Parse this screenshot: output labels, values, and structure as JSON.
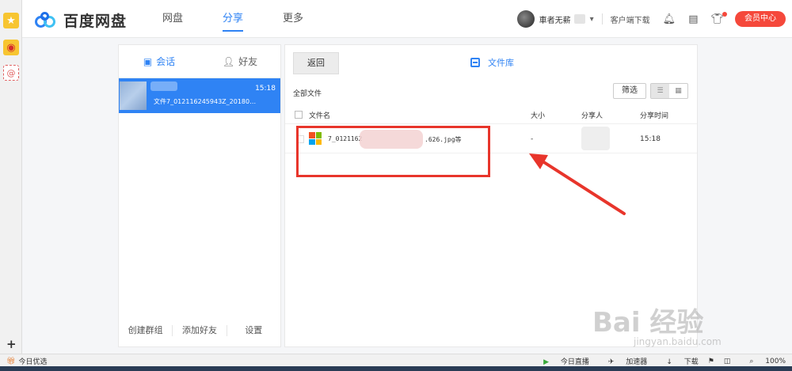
{
  "header": {
    "logo_text": "百度网盘",
    "nav": [
      "网盘",
      "分享",
      "更多"
    ],
    "active_nav": 1,
    "username": "車者无薪",
    "client_download": "客户端下载",
    "vip_button": "会员中心"
  },
  "chat": {
    "tabs": [
      "会话",
      "好友"
    ],
    "item": {
      "time": "15:18",
      "preview": "文件7_012116245943Z_20180…"
    },
    "footer": [
      "创建群组",
      "添加好友",
      "设置"
    ]
  },
  "files": {
    "back_label": "返回",
    "title": "文件库",
    "all_files": "全部文件",
    "filter_label": "筛选",
    "columns": [
      "文件名",
      "大小",
      "分享人",
      "分享时间"
    ],
    "row": {
      "name_start": "7_0121162",
      "name_end": ".626.jpg等",
      "size": "-",
      "time": "15:18"
    }
  },
  "statusbar": {
    "left": "今日优选",
    "right": [
      "今日直播",
      "加速器",
      "下载",
      "100%"
    ]
  },
  "watermark": {
    "main": "Bai 经验",
    "sub": "jingyan.baidu.com"
  },
  "colors": {
    "accent": "#2f83f4",
    "vip": "#f5483b",
    "annotation": "#e8352b"
  }
}
